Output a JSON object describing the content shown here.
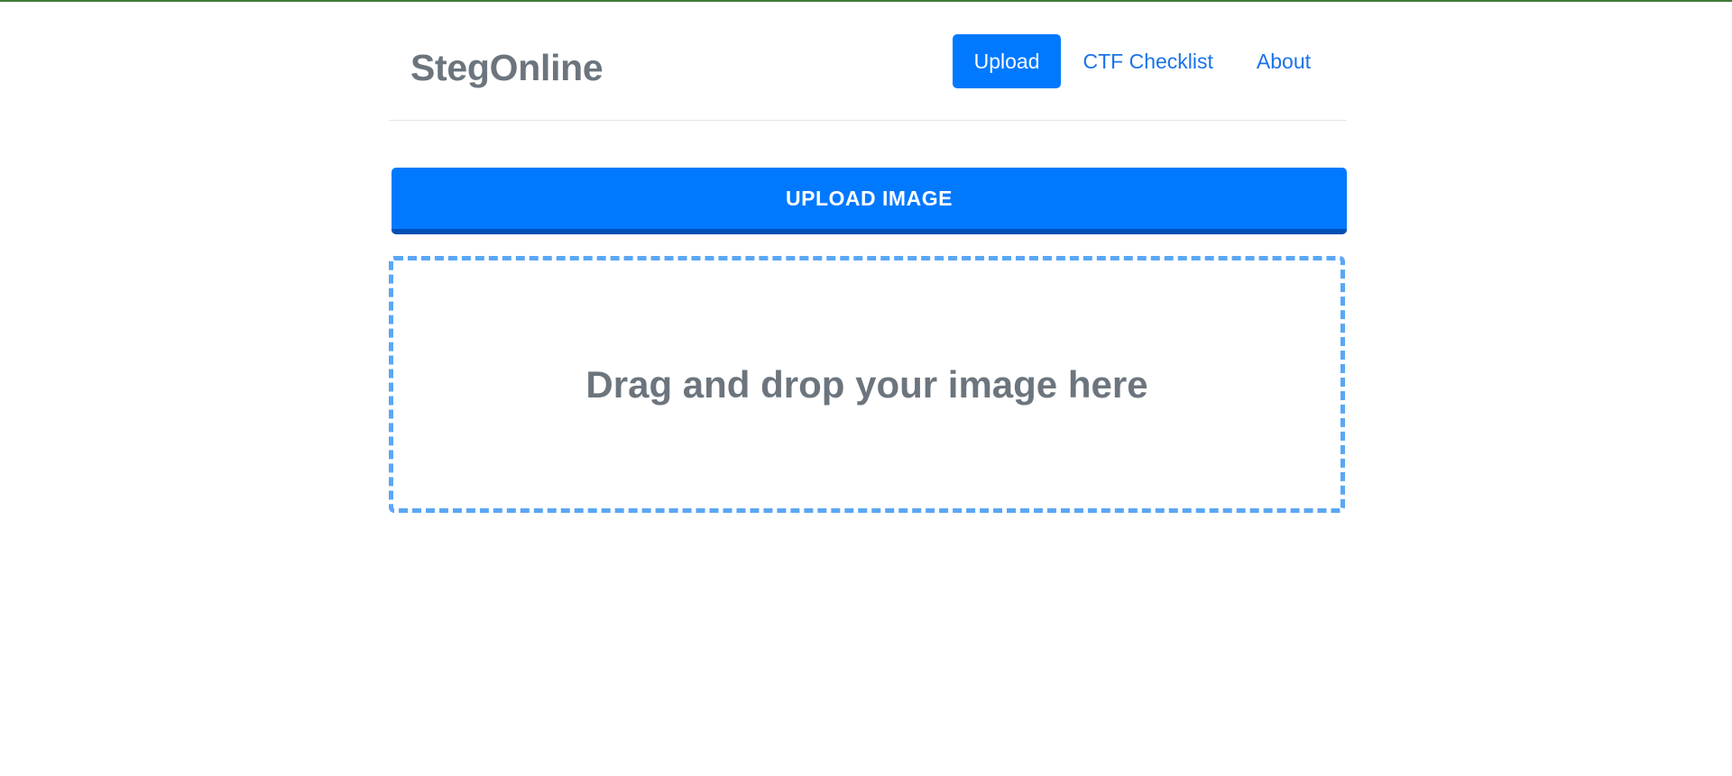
{
  "header": {
    "brand": "StegOnline",
    "nav": [
      {
        "label": "Upload",
        "active": true
      },
      {
        "label": "CTF Checklist",
        "active": false
      },
      {
        "label": "About",
        "active": false
      }
    ]
  },
  "main": {
    "upload_button_label": "UPLOAD IMAGE",
    "dropzone_text": "Drag and drop your image here"
  },
  "colors": {
    "accent": "#0079ff",
    "accent_dark": "#0050b5",
    "dropzone_border": "#5aa7f5",
    "muted_text": "#6c757d"
  }
}
